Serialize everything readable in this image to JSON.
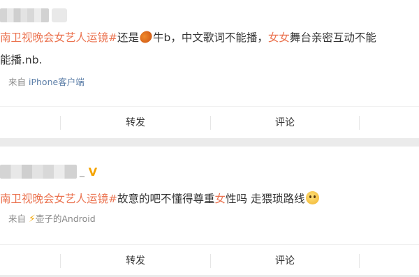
{
  "posts": [
    {
      "text": {
        "hashtag": "南卫视晚会女艺人运镜#",
        "part1": "还是",
        "part2": "牛b，中文歌词不能播，",
        "highlight": "女女",
        "part3": "舞台亲密互动不能",
        "line2": "能播.nb."
      },
      "meta": {
        "prefix": "来自",
        "source": "iPhone客户端"
      },
      "actions": {
        "repost": "转发",
        "comment": "评论"
      }
    },
    {
      "author_suffix": "_",
      "text": {
        "hashtag": "南卫视晚会女艺人运镜#",
        "part1": "故意的吧不懂得尊重",
        "highlight": "女",
        "part2": "性吗 走猥琐路线"
      },
      "meta": {
        "prefix": "来自",
        "source": "壶子的Android"
      },
      "actions": {
        "repost": "转发",
        "comment": "评论"
      }
    }
  ],
  "colors": {
    "highlight": "#eb7350",
    "vip": "#f4a300",
    "background": "#ebebeb"
  },
  "icons": [
    "peach-emoji-icon",
    "vip-crown-icon",
    "lightning-icon",
    "cheeky-face-emoji-icon"
  ]
}
